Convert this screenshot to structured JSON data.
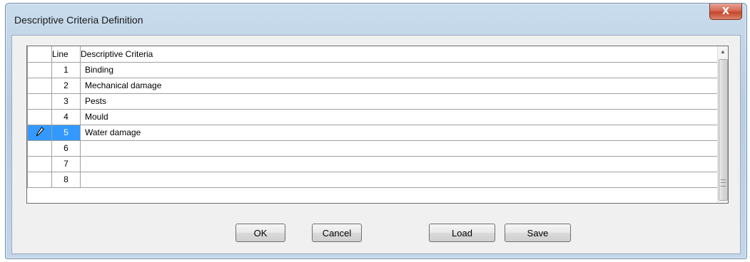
{
  "window": {
    "title": "Descriptive Criteria Definition",
    "close_glyph": "X"
  },
  "grid": {
    "columns": {
      "line": "Line",
      "criteria": "Descriptive Criteria"
    },
    "rows": [
      {
        "line": "1",
        "criteria": "Binding"
      },
      {
        "line": "2",
        "criteria": "Mechanical damage"
      },
      {
        "line": "3",
        "criteria": "Pests"
      },
      {
        "line": "4",
        "criteria": "Mould"
      },
      {
        "line": "5",
        "criteria": "Water damage",
        "editing": true
      },
      {
        "line": "6",
        "criteria": ""
      },
      {
        "line": "7",
        "criteria": ""
      },
      {
        "line": "8",
        "criteria": ""
      }
    ],
    "edit_icon": "pencil-icon"
  },
  "buttons": {
    "ok": "OK",
    "cancel": "Cancel",
    "load": "Load",
    "save": "Save"
  },
  "colors": {
    "selection": "#3399ff",
    "close": "#c6462c"
  }
}
